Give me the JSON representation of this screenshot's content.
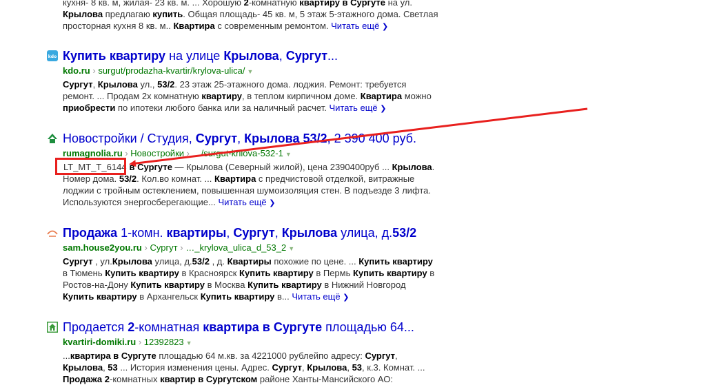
{
  "results": [
    {
      "snippet_html": "кухня- 8 кв. м, жилая- 23 кв. м. ... Хорошую <b>2</b>-комнатную <b>квартиру в Сургуте</b> на ул. <b>Крылова</b> предлагаю <b>купить</b>. Общая площадь- 45 кв. м, 5 этаж 5-этажного дома. Светлая просторная кухня 8 кв. м.. <b>Квартира</b> с современным ремонтом.",
      "read_more": "Читать ещё"
    },
    {
      "title_html": "<b>Купить квартиру</b> на улице <b>Крылова</b>, <b>Сургут</b>...",
      "host": "kdo.ru",
      "path": "surgut/prodazha-kvartir/krylova-ulica/",
      "favicon": "kdo-icon",
      "snippet_html": "<b>Сургут</b>, <b>Крылова</b> ул., <b>53/2</b>. 23 этаж 25-этажного дома. лоджия. Ремонт: требуется ремонт. ... Продам 2х комнатную <b>квартиру</b>, в теплом кирпичном доме. <b>Квартира</b> можно <b>приобрести</b> по ипотеки любого банка или за наличный расчет.",
      "read_more": "Читать ещё"
    },
    {
      "title_html": "Новостройки / Студия, <b>Сургут</b>, <b>Крылова</b> <b>53/2</b>, 2 390 400 руб.",
      "host": "rumagnolia.ru",
      "path_parts": [
        "Новостройки",
        "…/surgut-krilova-532-1"
      ],
      "favicon": "house-roof-icon",
      "code": "LT_MT_T_6144",
      "snippet_html": "<b>в Сургуте</b> — Крылова (Северный жилой), цена 2390400руб ... <b>Крылова</b>. Номер дома. <b>53/2</b>. Кол.во комнат. ... <b>Квартира</b> с предчистовой отделкой, витражные лоджии с тройным остеклением, повышенная шумоизоляция стен. В подъезде 3 лифта. Используются энергосберегающие...",
      "read_more": "Читать ещё"
    },
    {
      "title_html": "<b>Продажа</b> 1-комн. <b>квартиры</b>, <b>Сургут</b>, <b>Крылова</b> улица, д.<b>53/2</b>",
      "host": "sam.house2you.ru",
      "path_parts": [
        "Сургут",
        "…_krylova_ulica_d_53_2"
      ],
      "favicon": "roof-outline-icon",
      "snippet_html": "<b>Сургут</b> , ул.<b>Крылова</b> улица, д.<b>53/2</b> , д. <b>Квартиры</b> похожие по цене. ... <b>Купить квартиру</b> в Тюмень <b>Купить квартиру</b> в Красноярск <b>Купить квартиру</b> в Пермь <b>Купить квартиру</b> в Ростов-на-Дону <b>Купить квартиру</b> в Москва <b>Купить квартиру</b> в Нижний Новгород <b>Купить квартиру</b> в Архангельск <b>Купить квартиру</b> в...",
      "read_more": "Читать ещё"
    },
    {
      "title_html": "Продается <b>2</b>-комнатная <b>квартира в Сургуте</b> площадью 64...",
      "host": "kvartiri-domiki.ru",
      "path_parts": [
        "12392823"
      ],
      "favicon": "green-house-icon",
      "snippet_html": "...<b>квартира в Сургуте</b> площадью 64 м.кв. за 4221000 рублейпо адресу: <b>Сургут</b>, <b>Крылова</b>, <b>53</b> ... История изменения цены. Адрес. <b>Сургут</b>, <b>Крылова</b>, <b>53</b>, к.3. Комнат. ... <b>Продажа</b> <b>2</b>-комнатных <b>квартир в Сургутском</b> районе Ханты-Мансийского АО:"
    }
  ],
  "colors": {
    "link": "#0000cc",
    "url_green": "#007700",
    "annotation_red": "#e8201e",
    "snippet_text": "#333333"
  }
}
